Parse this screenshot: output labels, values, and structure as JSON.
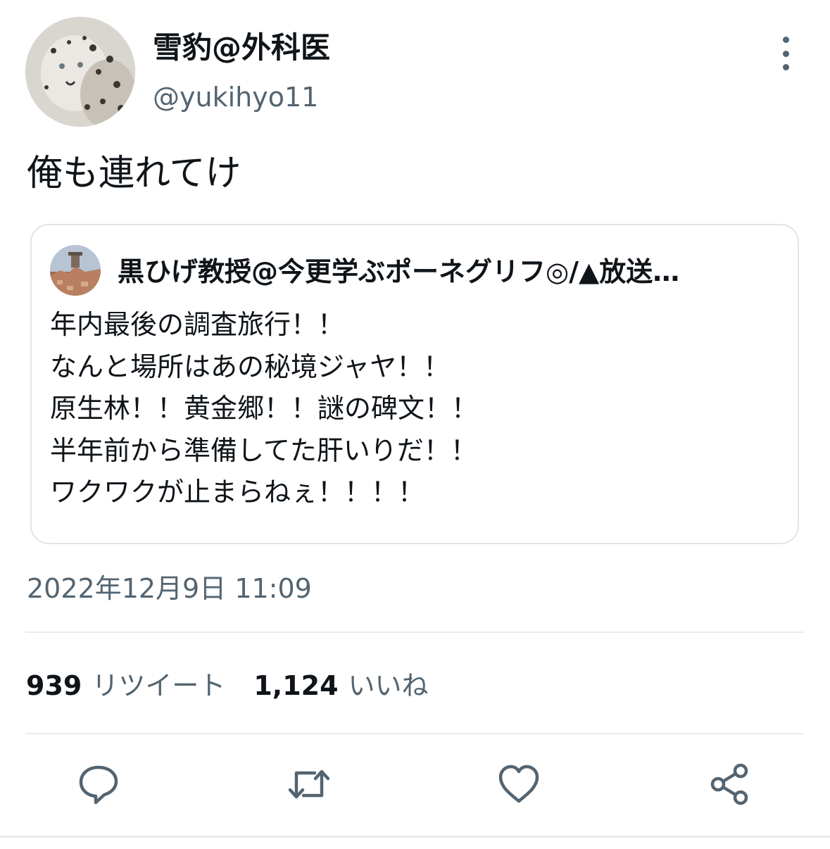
{
  "author": {
    "display_name": "雪豹@外科医",
    "handle": "@yukihyo11",
    "avatar_icon": "snow-leopard-avatar"
  },
  "tweet": {
    "text": "俺も連れてけ",
    "timestamp": "2022年12月9日 11:09"
  },
  "quote": {
    "display_name": "黒ひげ教授@今更学ぶポーネグリフ◎/▲放送…",
    "avatar_icon": "ruins-avatar",
    "lines": [
      "年内最後の調査旅行！！",
      "なんと場所はあの秘境ジャヤ！！",
      "原生林！！黄金郷！！謎の碑文！！",
      "半年前から準備してた肝いりだ！！",
      "ワクワクが止まらねぇ！！！！"
    ]
  },
  "stats": {
    "retweets_count": "939",
    "retweets_label": "リツイート",
    "likes_count": "1,124",
    "likes_label": "いいね"
  },
  "actions": [
    {
      "name": "reply",
      "icon": "speech-bubble-icon"
    },
    {
      "name": "retweet",
      "icon": "retweet-icon"
    },
    {
      "name": "like",
      "icon": "heart-icon"
    },
    {
      "name": "share",
      "icon": "share-icon"
    }
  ],
  "colors": {
    "text_primary": "#0f1419",
    "text_secondary": "#536471",
    "border": "#dfe4e8",
    "divider": "#e6ecf0"
  }
}
